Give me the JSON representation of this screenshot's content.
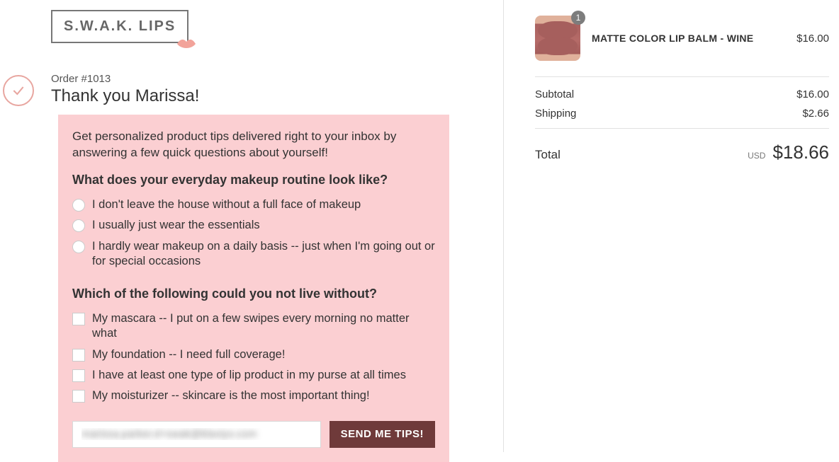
{
  "brand": {
    "name": "S.W.A.K. LIPS"
  },
  "order": {
    "number": "Order #1013",
    "thank_you": "Thank you Marissa!"
  },
  "survey": {
    "intro": "Get personalized product tips delivered right to your inbox by answering a few quick questions about yourself!",
    "q1": {
      "text": "What does your everyday makeup routine look like?",
      "options": [
        "I don't leave the house without a full face of makeup",
        "I usually just wear the essentials",
        "I hardly wear makeup on a daily basis -- just when I'm going out or for special occasions"
      ]
    },
    "q2": {
      "text": "Which of the following could you not live without?",
      "options": [
        "My mascara -- I put on a few swipes every morning no matter what",
        "My foundation -- I need full coverage!",
        "I have at least one type of lip product in my purse at all times",
        "My moisturizer -- skincare is the most important thing!"
      ]
    },
    "email_value": "marissa.parker.d+swak@klaviyo.com",
    "submit_label": "SEND ME TIPS!"
  },
  "cart": {
    "product": {
      "name": "MATTE COLOR LIP BALM - WINE",
      "price": "$16.00",
      "qty": "1"
    },
    "subtotal_label": "Subtotal",
    "subtotal_value": "$16.00",
    "shipping_label": "Shipping",
    "shipping_value": "$2.66",
    "total_label": "Total",
    "currency": "USD",
    "total_value": "$18.66"
  }
}
